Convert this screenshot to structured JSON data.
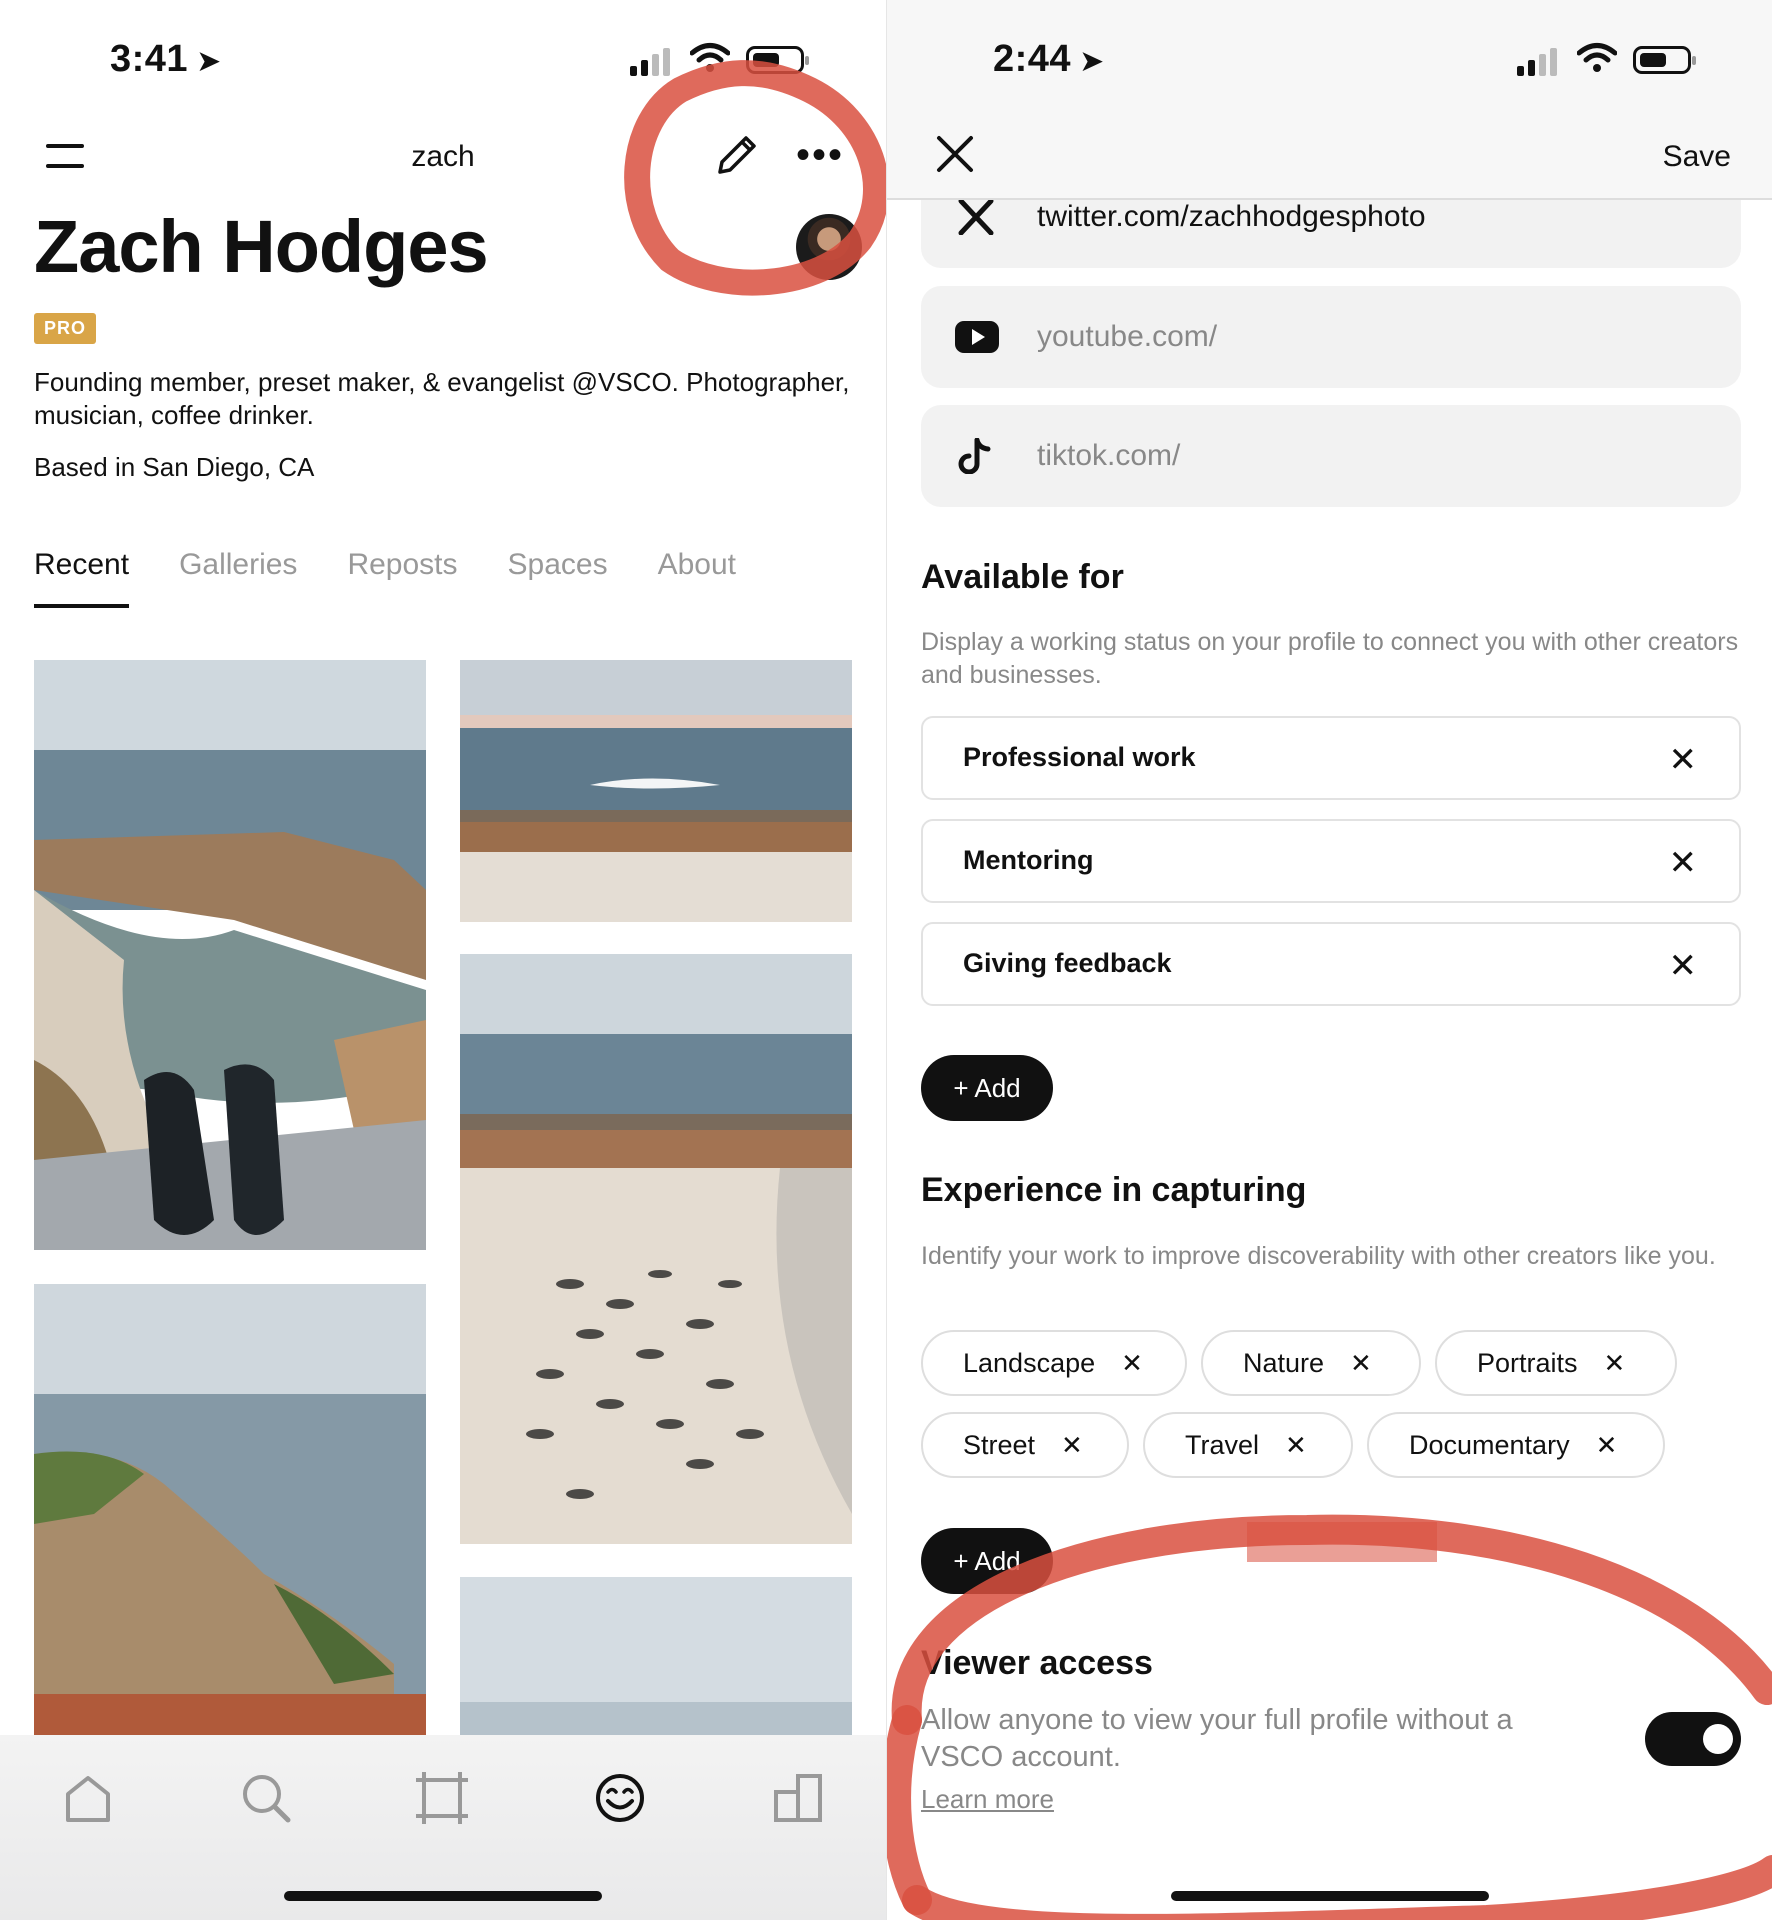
{
  "left": {
    "status": {
      "time": "3:41"
    },
    "header": {
      "username": "zach"
    },
    "profile": {
      "name": "Zach Hodges",
      "badge": "PRO",
      "bio": "Founding member, preset maker, & evangelist @VSCO. Photographer, musician, coffee drinker.",
      "location": "Based in San Diego, CA"
    },
    "tabs": [
      "Recent",
      "Galleries",
      "Reposts",
      "Spaces",
      "About"
    ],
    "nav": [
      "home-icon",
      "search-icon",
      "crop-icon",
      "smiley-icon",
      "studio-icon"
    ]
  },
  "right": {
    "status": {
      "time": "2:44"
    },
    "header": {
      "save_label": "Save"
    },
    "socials": [
      {
        "icon": "x-logo-icon",
        "value": "twitter.com/zachhodgesphoto"
      },
      {
        "icon": "youtube-icon",
        "value": "youtube.com/"
      },
      {
        "icon": "tiktok-icon",
        "value": "tiktok.com/"
      }
    ],
    "available": {
      "title": "Available for",
      "description": "Display a working status on your profile to connect you with other creators and businesses.",
      "items": [
        "Professional work",
        "Mentoring",
        "Giving feedback"
      ],
      "add_label": "+ Add"
    },
    "experience": {
      "title": "Experience in capturing",
      "description": "Identify your work to improve discoverability with other creators like you.",
      "chips": [
        "Landscape",
        "Nature",
        "Portraits",
        "Street",
        "Travel",
        "Documentary"
      ],
      "add_label": "+ Add"
    },
    "viewer": {
      "title": "Viewer access",
      "description": "Allow anyone to view your full profile without a VSCO account.",
      "learn_more": "Learn more",
      "enabled": true
    }
  },
  "colors": {
    "annotation": "#d9503f",
    "pro_badge": "#d9a547"
  }
}
